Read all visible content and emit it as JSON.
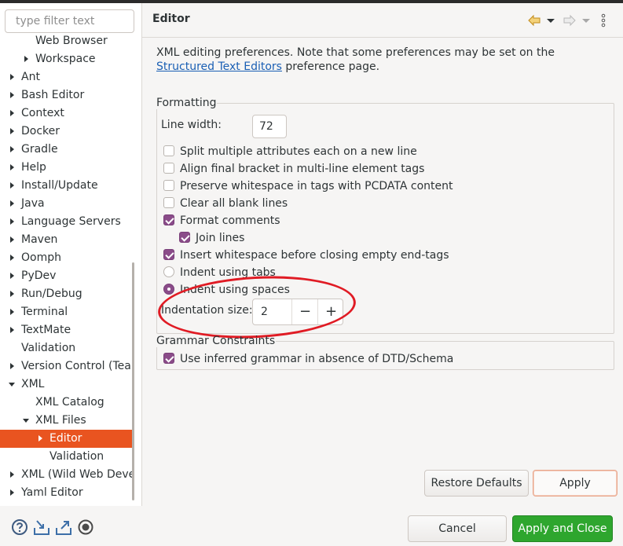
{
  "filter": {
    "placeholder": "type filter text"
  },
  "tree": [
    {
      "label": "Web Browser",
      "indent": 1,
      "arrow": "none",
      "selected": false
    },
    {
      "label": "Workspace",
      "indent": 1,
      "arrow": "right",
      "selected": false
    },
    {
      "label": "Ant",
      "indent": 0,
      "arrow": "right",
      "selected": false
    },
    {
      "label": "Bash Editor",
      "indent": 0,
      "arrow": "right",
      "selected": false
    },
    {
      "label": "Context",
      "indent": 0,
      "arrow": "right",
      "selected": false
    },
    {
      "label": "Docker",
      "indent": 0,
      "arrow": "right",
      "selected": false
    },
    {
      "label": "Gradle",
      "indent": 0,
      "arrow": "right",
      "selected": false
    },
    {
      "label": "Help",
      "indent": 0,
      "arrow": "right",
      "selected": false
    },
    {
      "label": "Install/Update",
      "indent": 0,
      "arrow": "right",
      "selected": false
    },
    {
      "label": "Java",
      "indent": 0,
      "arrow": "right",
      "selected": false
    },
    {
      "label": "Language Servers",
      "indent": 0,
      "arrow": "right",
      "selected": false
    },
    {
      "label": "Maven",
      "indent": 0,
      "arrow": "right",
      "selected": false
    },
    {
      "label": "Oomph",
      "indent": 0,
      "arrow": "right",
      "selected": false
    },
    {
      "label": "PyDev",
      "indent": 0,
      "arrow": "right",
      "selected": false
    },
    {
      "label": "Run/Debug",
      "indent": 0,
      "arrow": "right",
      "selected": false
    },
    {
      "label": "Terminal",
      "indent": 0,
      "arrow": "right",
      "selected": false
    },
    {
      "label": "TextMate",
      "indent": 0,
      "arrow": "right",
      "selected": false
    },
    {
      "label": "Validation",
      "indent": 0,
      "arrow": "none",
      "selected": false
    },
    {
      "label": "Version Control (Team)",
      "indent": 0,
      "arrow": "right",
      "selected": false
    },
    {
      "label": "XML",
      "indent": 0,
      "arrow": "down",
      "selected": false
    },
    {
      "label": "XML Catalog",
      "indent": 1,
      "arrow": "none",
      "selected": false
    },
    {
      "label": "XML Files",
      "indent": 1,
      "arrow": "down",
      "selected": false
    },
    {
      "label": "Editor",
      "indent": 2,
      "arrow": "right",
      "selected": true
    },
    {
      "label": "Validation",
      "indent": 2,
      "arrow": "none",
      "selected": false
    },
    {
      "label": "XML (Wild Web Developer)",
      "indent": 0,
      "arrow": "right",
      "selected": false
    },
    {
      "label": "Yaml Editor",
      "indent": 0,
      "arrow": "right",
      "selected": false
    }
  ],
  "page": {
    "title": "Editor",
    "description_pre": "XML editing preferences.  Note that some preferences may be set on the ",
    "description_link": "Structured Text Editors",
    "description_post": " preference page."
  },
  "formatting": {
    "legend": "Formatting",
    "line_width_label": "Line width:",
    "line_width_value": "72",
    "options": [
      {
        "label": "Split multiple attributes each on a new line",
        "checked": false,
        "type": "checkbox",
        "indent": 0
      },
      {
        "label": "Align final bracket in multi-line element tags",
        "checked": false,
        "type": "checkbox",
        "indent": 0
      },
      {
        "label": "Preserve whitespace in tags with PCDATA content",
        "checked": false,
        "type": "checkbox",
        "indent": 0
      },
      {
        "label": "Clear all blank lines",
        "checked": false,
        "type": "checkbox",
        "indent": 0
      },
      {
        "label": "Format comments",
        "checked": true,
        "type": "checkbox",
        "indent": 0
      },
      {
        "label": "Join lines",
        "checked": true,
        "type": "checkbox",
        "indent": 1
      },
      {
        "label": "Insert whitespace before closing empty end-tags",
        "checked": true,
        "type": "checkbox",
        "indent": 0
      },
      {
        "label": "Indent using tabs",
        "checked": false,
        "type": "radio",
        "indent": 0
      },
      {
        "label": "Indent using spaces",
        "checked": true,
        "type": "radio",
        "indent": 0
      }
    ],
    "indentation_label": "Indentation size:",
    "indentation_value": "2",
    "minus": "−",
    "plus": "+"
  },
  "grammar": {
    "legend": "Grammar Constraints",
    "option": {
      "label": "Use inferred grammar in absence of DTD/Schema",
      "checked": true
    }
  },
  "buttons": {
    "restore_defaults": "Restore Defaults",
    "apply": "Apply",
    "cancel": "Cancel",
    "apply_and_close": "Apply and Close"
  },
  "icons": {
    "nav_back": "back-arrow-icon",
    "nav_back_menu": "chevron-down-icon",
    "nav_forward": "forward-arrow-icon",
    "nav_forward_menu": "chevron-down-icon",
    "view_menu": "kebab-menu-icon",
    "help": "help-icon",
    "import": "import-icon",
    "export": "export-icon",
    "oomph": "record-icon"
  },
  "colors": {
    "selection": "#e95420",
    "checkbox_checked": "#8a4c89",
    "primary_button": "#2ea62e",
    "highlight_annotation": "#e01b24",
    "link": "#1a5fb4",
    "nav_back_arrow": "#e8b23a"
  }
}
